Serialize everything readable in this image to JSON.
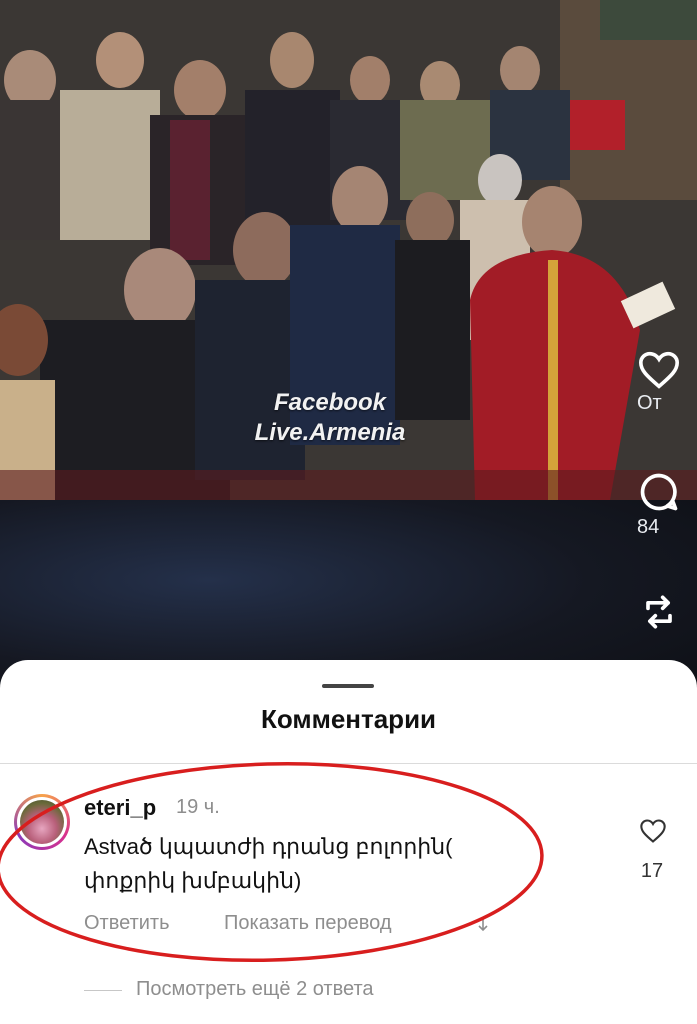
{
  "video": {
    "watermark_line1": "Facebook",
    "watermark_line2": "Live.Armenia",
    "actions": [
      {
        "icon": "heart-icon",
        "label": "От"
      },
      {
        "icon": "comment-icon",
        "label": "84"
      },
      {
        "icon": "repost-icon",
        "label": ""
      }
    ]
  },
  "sheet": {
    "title": "Комментарии"
  },
  "comment": {
    "username": "eteri_p",
    "time": "19 ч.",
    "text": "Astvaծ կպատժի դրանց բոլորին( փոքրիկ խմբակին)",
    "reply_label": "Ответить",
    "translate_label": "Показать перевод",
    "like_count": "17"
  },
  "view_replies": "Посмотреть ещё 2 ответа",
  "colors": {
    "annotation": "#d81e1e",
    "sheet_bg": "#ffffff",
    "muted_text": "#8e8e8e"
  }
}
